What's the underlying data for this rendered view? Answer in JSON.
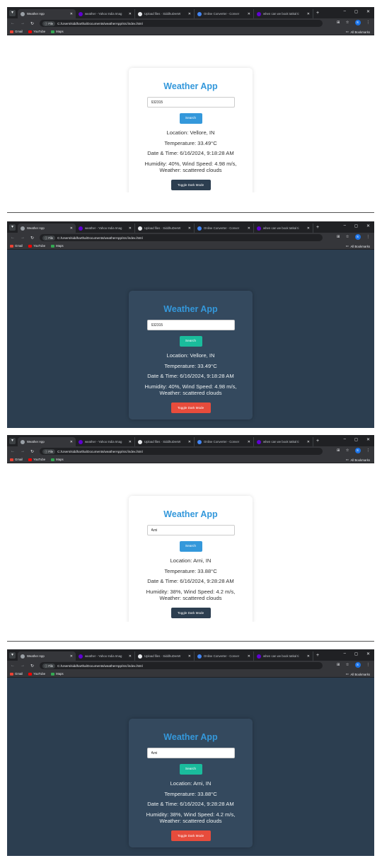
{
  "browser": {
    "tabs": [
      {
        "title": "Weather App",
        "color": "#9aa0a6"
      },
      {
        "title": "weather - Yahoo India Imag",
        "color": "#6001d2"
      },
      {
        "title": "Upload files · SiddhuDevW",
        "color": "#e8eaed"
      },
      {
        "title": "Online Converter - Conver",
        "color": "#4285f4"
      },
      {
        "title": "when can we book tatkal ti",
        "color": "#6001d2"
      }
    ],
    "new_tab": "+",
    "window_controls": [
      "–",
      "◻",
      "✕"
    ],
    "file_chip": "File",
    "url": "C:/Users/siddhartha/Documents/weatherApp/src/index.html",
    "profile_initial": "S",
    "bookmarks": [
      {
        "label": "Gmail",
        "color": "#ea4335"
      },
      {
        "label": "YouTube",
        "color": "#ff0000"
      },
      {
        "label": "Maps",
        "color": "#34a853"
      }
    ],
    "all_bookmarks": "All Bookmarks"
  },
  "shots": [
    {
      "theme": "light",
      "app_title": "Weather App",
      "city_input": "632315",
      "search_label": "Search",
      "location": "Location: Vellore, IN",
      "temperature": "Temperature: 33.49°C",
      "datetime": "Date & Time: 6/16/2024, 9:18:28 AM",
      "humidity_wind": "Humidity: 40%, Wind Speed: 4.98 m/s,",
      "weather": "Weather: scattered clouds",
      "toggle_label": "Toggle Dark Mode"
    },
    {
      "theme": "dark",
      "app_title": "Weather App",
      "city_input": "632315",
      "search_label": "Search",
      "location": "Location: Vellore, IN",
      "temperature": "Temperature: 33.49°C",
      "datetime": "Date & Time: 6/16/2024, 9:18:28 AM",
      "humidity_wind": "Humidity: 40%, Wind Speed: 4.98 m/s,",
      "weather": "Weather: scattered clouds",
      "toggle_label": "Toggle Dark Mode"
    },
    {
      "theme": "light",
      "app_title": "Weather App",
      "city_input": "Arni",
      "search_label": "Search",
      "location": "Location: Arni, IN",
      "temperature": "Temperature: 33.88°C",
      "datetime": "Date & Time: 6/16/2024, 9:28:28 AM",
      "humidity_wind": "Humidity: 38%, Wind Speed: 4.2 m/s,",
      "weather": "Weather: scattered clouds",
      "toggle_label": "Toggle Dark Mode"
    },
    {
      "theme": "dark",
      "app_title": "Weather App",
      "city_input": "Arni",
      "search_label": "Search",
      "location": "Location: Arni, IN",
      "temperature": "Temperature: 33.88°C",
      "datetime": "Date & Time: 6/16/2024, 9:28:28 AM",
      "humidity_wind": "Humidity: 38%, Wind Speed: 4.2 m/s,",
      "weather": "Weather: scattered clouds",
      "toggle_label": "Toggle Dark Mode"
    }
  ]
}
